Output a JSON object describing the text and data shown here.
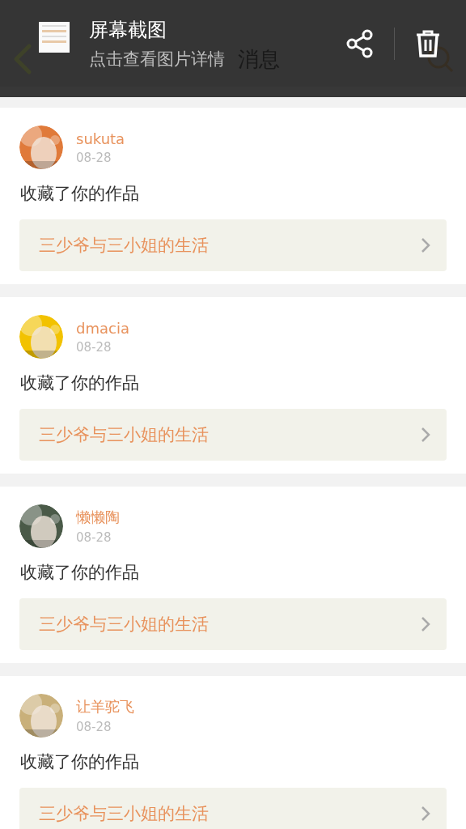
{
  "app_header": {
    "title": "消息"
  },
  "screenshot_notice": {
    "title": "屏幕截图",
    "subtitle": "点击查看图片详情"
  },
  "messages": [
    {
      "user": "sukuta",
      "date": "08-28",
      "action": "收藏了你的作品",
      "work": "三少爷与三小姐的生活"
    },
    {
      "user": "dmacia",
      "date": "08-28",
      "action": "收藏了你的作品",
      "work": "三少爷与三小姐的生活"
    },
    {
      "user": "懒懒陶",
      "date": "08-28",
      "action": "收藏了你的作品",
      "work": "三少爷与三小姐的生活"
    },
    {
      "user": "让羊驼飞",
      "date": "08-28",
      "action": "收藏了你的作品",
      "work": "三少爷与三小姐的生活"
    }
  ]
}
